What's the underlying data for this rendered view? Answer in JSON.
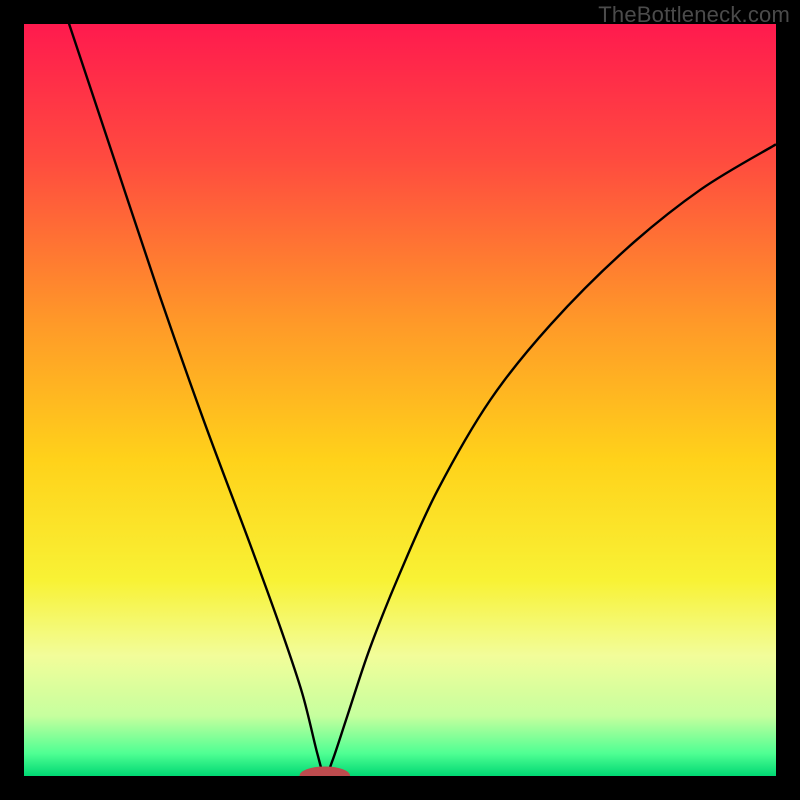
{
  "watermark": "TheBottleneck.com",
  "colors": {
    "frame": "#000000",
    "curve": "#000000",
    "marker_fill": "#bd4b4e",
    "marker_stroke": "#bd4b4e",
    "gradient_stops": [
      {
        "offset": "0%",
        "color": "#ff1a4e"
      },
      {
        "offset": "18%",
        "color": "#ff4b3f"
      },
      {
        "offset": "40%",
        "color": "#ff9a28"
      },
      {
        "offset": "58%",
        "color": "#ffd21a"
      },
      {
        "offset": "74%",
        "color": "#f8f235"
      },
      {
        "offset": "84%",
        "color": "#f2fd9a"
      },
      {
        "offset": "92%",
        "color": "#c6ff9e"
      },
      {
        "offset": "97%",
        "color": "#4fff93"
      },
      {
        "offset": "100%",
        "color": "#00d873"
      }
    ]
  },
  "chart_data": {
    "type": "line",
    "title": "",
    "xlabel": "",
    "ylabel": "",
    "xlim": [
      0,
      100
    ],
    "ylim": [
      0,
      100
    ],
    "grid": false,
    "legend": false,
    "optimum_x": 40,
    "series": [
      {
        "name": "bottleneck-curve",
        "x": [
          0,
          6,
          12,
          18,
          24,
          30,
          34,
          37,
          39,
          40,
          41,
          43,
          46,
          50,
          55,
          62,
          70,
          80,
          90,
          100
        ],
        "y": [
          118,
          100,
          82,
          64,
          47,
          31,
          20,
          11,
          3,
          0,
          2,
          8,
          17,
          27,
          38,
          50,
          60,
          70,
          78,
          84
        ]
      }
    ],
    "marker": {
      "x": 40,
      "y": 0,
      "rx": 3.3,
      "ry": 1.2
    }
  }
}
